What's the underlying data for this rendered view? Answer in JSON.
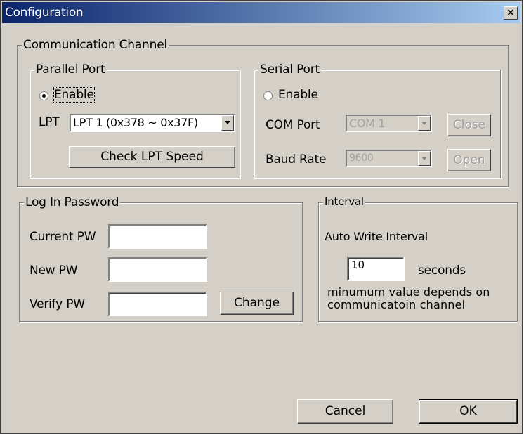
{
  "window": {
    "title": "Configuration",
    "close_glyph": "×"
  },
  "comm": {
    "legend": "Communication Channel",
    "parallel": {
      "legend": "Parallel Port",
      "enable_label": "Enable",
      "enable_selected": true,
      "lpt_label": "LPT",
      "lpt_value": "LPT 1 (0x378 ~ 0x37F)",
      "check_speed_label": "Check LPT Speed"
    },
    "serial": {
      "legend": "Serial Port",
      "enable_label": "Enable",
      "enable_selected": false,
      "com_label": "COM Port",
      "com_value": "COM 1",
      "baud_label": "Baud Rate",
      "baud_value": "9600",
      "close_label": "Close",
      "open_label": "Open"
    }
  },
  "login": {
    "legend": "Log In Password",
    "current_label": "Current PW",
    "new_label": "New PW",
    "verify_label": "Verify PW",
    "change_label": "Change"
  },
  "interval": {
    "legend": "Interval",
    "auto_label": "Auto Write Interval",
    "value": "10",
    "unit": "seconds",
    "note_line1": "minumum value depends on",
    "note_line2": "communicatoin channel"
  },
  "footer": {
    "cancel_label": "Cancel",
    "ok_label": "OK"
  }
}
